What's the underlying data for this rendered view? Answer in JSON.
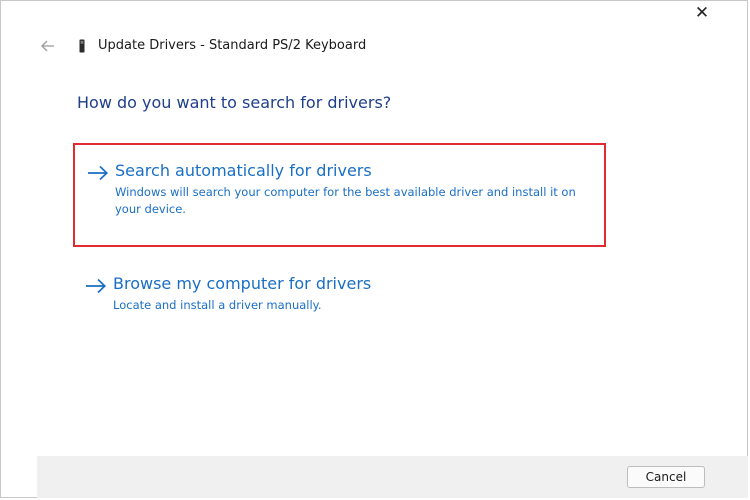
{
  "window": {
    "title": "Update Drivers - Standard PS/2 Keyboard",
    "close_label": "✕"
  },
  "heading": "How do you want to search for drivers?",
  "options": [
    {
      "title": "Search automatically for drivers",
      "description": "Windows will search your computer for the best available driver and install it on your device.",
      "highlighted": true,
      "highlight_color": "#e12a32"
    },
    {
      "title": "Browse my computer for drivers",
      "description": "Locate and install a driver manually.",
      "highlighted": false
    }
  ],
  "footer": {
    "cancel_label": "Cancel"
  },
  "colors": {
    "accent": "#1a6fc4",
    "heading": "#1f3f8a",
    "footer_bg": "#f0f0f0"
  },
  "icons": {
    "back": "arrow-left-icon",
    "device": "keyboard-device-icon",
    "option": "arrow-right-icon",
    "close": "close-icon"
  }
}
